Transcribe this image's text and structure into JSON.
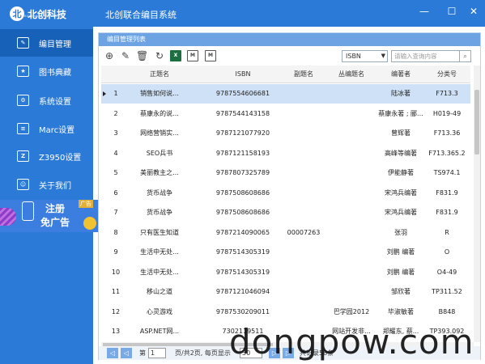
{
  "app": {
    "logo_text": "北创科技",
    "logo_subtext": "BEICHUANG TECHNOLOGY",
    "title": "北创联合编目系统"
  },
  "window": {
    "minimize": "—",
    "maximize": "☐",
    "close": "✕"
  },
  "sidebar": {
    "items": [
      {
        "label": "编目管理",
        "icon": "edit-icon"
      },
      {
        "label": "图书典藏",
        "icon": "star-book-icon"
      },
      {
        "label": "系统设置",
        "icon": "settings-icon"
      },
      {
        "label": "Marc设置",
        "icon": "marc-icon"
      },
      {
        "label": "Z3950设置",
        "icon": "z3950-icon"
      },
      {
        "label": "关于我们",
        "icon": "person-icon"
      }
    ],
    "ad": {
      "title": "注册",
      "subtitle": "免广告",
      "tag": "广告"
    }
  },
  "panel": {
    "title": "编目管理列表"
  },
  "toolbar": {
    "buttons": [
      "add-icon",
      "edit-icon",
      "delete-icon",
      "refresh-icon",
      "import-excel-icon",
      "export-marc-icon",
      "export-marc2-icon"
    ],
    "field_select": "ISBN",
    "search_placeholder": "请输入查询内容"
  },
  "grid": {
    "columns": [
      "",
      "正题名",
      "ISBN",
      "副题名",
      "丛编题名",
      "编著者",
      "分类号"
    ],
    "rows": [
      [
        "1",
        "销售如何说...",
        "9787554606681",
        "",
        "",
        "陆冰著",
        "F713.3"
      ],
      [
        "2",
        "蔡康永的说...",
        "9787544143158",
        "",
        "",
        "蔡康永著 ; 郦...",
        "H019-49"
      ],
      [
        "3",
        "网络营销实...",
        "9787121077920",
        "",
        "",
        "曾辉著",
        "F713.36"
      ],
      [
        "4",
        "SEO兵书",
        "9787121158193",
        "",
        "",
        "高峰等编著",
        "F713.365.2"
      ],
      [
        "5",
        "美丽教主之...",
        "9787807325789",
        "",
        "",
        "伊能静著",
        "TS974.1"
      ],
      [
        "6",
        "货币战争",
        "9787508608686",
        "",
        "",
        "宋鸿兵编著",
        "F831.9"
      ],
      [
        "7",
        "货币战争",
        "9787508608686",
        "",
        "",
        "宋鸿兵编著",
        "F831.9"
      ],
      [
        "8",
        "只有医生知道",
        "9787214090065",
        "00007263",
        "",
        "张羽",
        "R"
      ],
      [
        "9",
        "生活中无处...",
        "9787514305319",
        "",
        "",
        "刘鹏 编著",
        "O"
      ],
      [
        "10",
        "生活中无处...",
        "9787514305319",
        "",
        "",
        "刘鹏 编著",
        "O4-49"
      ],
      [
        "11",
        "移山之道",
        "9787121046094",
        "",
        "",
        "邹欣著",
        "TP311.52"
      ],
      [
        "12",
        "心灵游戏",
        "9787530209011",
        "",
        "巴学园2012",
        "毕淑敏著",
        "B848"
      ],
      [
        "13",
        "ASP.NET网...",
        "7302119511",
        "",
        "网站开发非...",
        "郑耀东, 蔡...",
        "TP393.092"
      ]
    ]
  },
  "pager": {
    "first": "◁",
    "prev": "◁",
    "page_label": "第",
    "page_value": "1",
    "page_total": "页/共2页, 每页显示",
    "page_size": "50",
    "next": "▷",
    "last": "▷",
    "record_total": "共记录58条"
  },
  "watermark": "dongpow.com"
}
